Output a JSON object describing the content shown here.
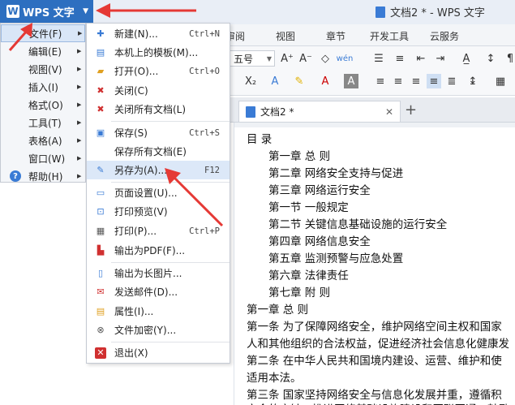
{
  "app": {
    "name": "WPS 文字",
    "window_title": "文档2 * - WPS 文字"
  },
  "ribbon_tabs": [
    "审阅",
    "视图",
    "章节",
    "开发工具",
    "云服务"
  ],
  "toolbar": {
    "font_size": "五号"
  },
  "doc_tab": {
    "title": "文档2 *",
    "close": "✕",
    "add": "+"
  },
  "main_menu": [
    {
      "label": "文件(F)",
      "has_submenu": true,
      "active": true
    },
    {
      "label": "编辑(E)",
      "has_submenu": true
    },
    {
      "label": "视图(V)",
      "has_submenu": true
    },
    {
      "label": "插入(I)",
      "has_submenu": true
    },
    {
      "label": "格式(O)",
      "has_submenu": true
    },
    {
      "label": "工具(T)",
      "has_submenu": true
    },
    {
      "label": "表格(A)",
      "has_submenu": true
    },
    {
      "label": "窗口(W)",
      "has_submenu": true
    },
    {
      "label": "帮助(H)",
      "has_submenu": true
    }
  ],
  "file_menu": [
    {
      "label": "新建(N)...",
      "shortcut": "Ctrl+N",
      "icon": "new-doc-icon"
    },
    {
      "label": "本机上的模板(M)...",
      "shortcut": "",
      "icon": "template-icon"
    },
    {
      "label": "打开(O)...",
      "shortcut": "Ctrl+O",
      "icon": "open-folder-icon"
    },
    {
      "label": "关闭(C)",
      "shortcut": "",
      "icon": "close-doc-icon"
    },
    {
      "label": "关闭所有文档(L)",
      "shortcut": "",
      "icon": "close-all-icon"
    },
    {
      "label": "保存(S)",
      "shortcut": "Ctrl+S",
      "icon": "save-icon"
    },
    {
      "label": "保存所有文档(E)",
      "shortcut": "",
      "icon": ""
    },
    {
      "label": "另存为(A)...",
      "shortcut": "F12",
      "icon": "save-as-icon",
      "active": true
    },
    {
      "label": "页面设置(U)...",
      "shortcut": "",
      "icon": "page-setup-icon"
    },
    {
      "label": "打印预览(V)",
      "shortcut": "",
      "icon": "print-preview-icon"
    },
    {
      "label": "打印(P)...",
      "shortcut": "Ctrl+P",
      "icon": "print-icon"
    },
    {
      "label": "输出为PDF(F)...",
      "shortcut": "",
      "icon": "pdf-icon"
    },
    {
      "label": "输出为长图片...",
      "shortcut": "",
      "icon": "long-image-icon"
    },
    {
      "label": "发送邮件(D)...",
      "shortcut": "",
      "icon": "mail-icon"
    },
    {
      "label": "属性(I)...",
      "shortcut": "",
      "icon": "properties-icon"
    },
    {
      "label": "文件加密(Y)...",
      "shortcut": "",
      "icon": "encrypt-icon"
    },
    {
      "label": "退出(X)",
      "shortcut": "",
      "icon": "exit-icon"
    }
  ],
  "document_lines": [
    "目    录",
    "第一章  总      则",
    "第二章  网络安全支持与促进",
    "第三章  网络运行安全",
    "第一节  一般规定",
    "第二节  关键信息基础设施的运行安全",
    "第四章  网络信息安全",
    "第五章  监测预警与应急处置",
    "第六章  法律责任",
    "第七章  附      则",
    "第一章  总      则",
    "第一条    为了保障网络安全，维护网络空间主权和国家",
    "人和其他组织的合法权益，促进经济社会信息化健康发",
    "第二条    在中华人民共和国境内建设、运营、维护和使",
    "适用本法。",
    "第三条    国家坚持网络安全与信息化发展并重，遵循积",
    "安全的方针，推进网络基础设施建设和互联互通，鼓励"
  ],
  "colors": {
    "accent": "#2d6fc0",
    "annotation_arrow": "#e53935"
  }
}
